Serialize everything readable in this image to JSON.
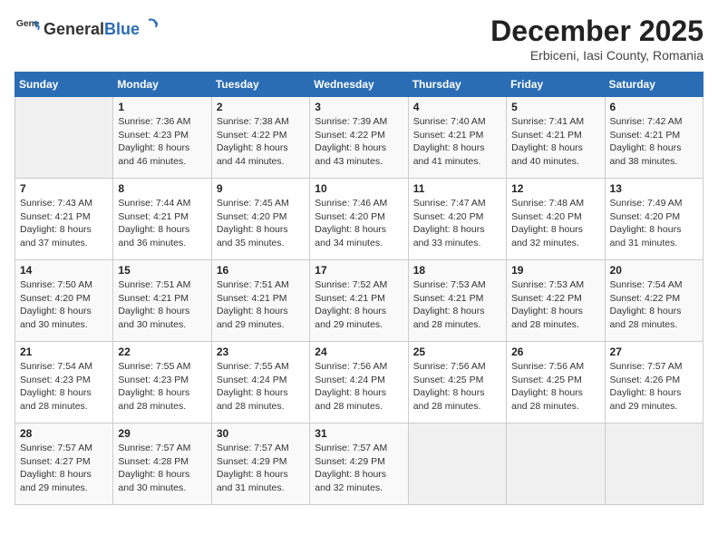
{
  "logo": {
    "general": "General",
    "blue": "Blue"
  },
  "header": {
    "title": "December 2025",
    "subtitle": "Erbiceni, Iasi County, Romania"
  },
  "weekdays": [
    "Sunday",
    "Monday",
    "Tuesday",
    "Wednesday",
    "Thursday",
    "Friday",
    "Saturday"
  ],
  "weeks": [
    [
      {
        "day": "",
        "info": ""
      },
      {
        "day": "1",
        "info": "Sunrise: 7:36 AM\nSunset: 4:23 PM\nDaylight: 8 hours\nand 46 minutes."
      },
      {
        "day": "2",
        "info": "Sunrise: 7:38 AM\nSunset: 4:22 PM\nDaylight: 8 hours\nand 44 minutes."
      },
      {
        "day": "3",
        "info": "Sunrise: 7:39 AM\nSunset: 4:22 PM\nDaylight: 8 hours\nand 43 minutes."
      },
      {
        "day": "4",
        "info": "Sunrise: 7:40 AM\nSunset: 4:21 PM\nDaylight: 8 hours\nand 41 minutes."
      },
      {
        "day": "5",
        "info": "Sunrise: 7:41 AM\nSunset: 4:21 PM\nDaylight: 8 hours\nand 40 minutes."
      },
      {
        "day": "6",
        "info": "Sunrise: 7:42 AM\nSunset: 4:21 PM\nDaylight: 8 hours\nand 38 minutes."
      }
    ],
    [
      {
        "day": "7",
        "info": "Sunrise: 7:43 AM\nSunset: 4:21 PM\nDaylight: 8 hours\nand 37 minutes."
      },
      {
        "day": "8",
        "info": "Sunrise: 7:44 AM\nSunset: 4:21 PM\nDaylight: 8 hours\nand 36 minutes."
      },
      {
        "day": "9",
        "info": "Sunrise: 7:45 AM\nSunset: 4:20 PM\nDaylight: 8 hours\nand 35 minutes."
      },
      {
        "day": "10",
        "info": "Sunrise: 7:46 AM\nSunset: 4:20 PM\nDaylight: 8 hours\nand 34 minutes."
      },
      {
        "day": "11",
        "info": "Sunrise: 7:47 AM\nSunset: 4:20 PM\nDaylight: 8 hours\nand 33 minutes."
      },
      {
        "day": "12",
        "info": "Sunrise: 7:48 AM\nSunset: 4:20 PM\nDaylight: 8 hours\nand 32 minutes."
      },
      {
        "day": "13",
        "info": "Sunrise: 7:49 AM\nSunset: 4:20 PM\nDaylight: 8 hours\nand 31 minutes."
      }
    ],
    [
      {
        "day": "14",
        "info": "Sunrise: 7:50 AM\nSunset: 4:20 PM\nDaylight: 8 hours\nand 30 minutes."
      },
      {
        "day": "15",
        "info": "Sunrise: 7:51 AM\nSunset: 4:21 PM\nDaylight: 8 hours\nand 30 minutes."
      },
      {
        "day": "16",
        "info": "Sunrise: 7:51 AM\nSunset: 4:21 PM\nDaylight: 8 hours\nand 29 minutes."
      },
      {
        "day": "17",
        "info": "Sunrise: 7:52 AM\nSunset: 4:21 PM\nDaylight: 8 hours\nand 29 minutes."
      },
      {
        "day": "18",
        "info": "Sunrise: 7:53 AM\nSunset: 4:21 PM\nDaylight: 8 hours\nand 28 minutes."
      },
      {
        "day": "19",
        "info": "Sunrise: 7:53 AM\nSunset: 4:22 PM\nDaylight: 8 hours\nand 28 minutes."
      },
      {
        "day": "20",
        "info": "Sunrise: 7:54 AM\nSunset: 4:22 PM\nDaylight: 8 hours\nand 28 minutes."
      }
    ],
    [
      {
        "day": "21",
        "info": "Sunrise: 7:54 AM\nSunset: 4:23 PM\nDaylight: 8 hours\nand 28 minutes."
      },
      {
        "day": "22",
        "info": "Sunrise: 7:55 AM\nSunset: 4:23 PM\nDaylight: 8 hours\nand 28 minutes."
      },
      {
        "day": "23",
        "info": "Sunrise: 7:55 AM\nSunset: 4:24 PM\nDaylight: 8 hours\nand 28 minutes."
      },
      {
        "day": "24",
        "info": "Sunrise: 7:56 AM\nSunset: 4:24 PM\nDaylight: 8 hours\nand 28 minutes."
      },
      {
        "day": "25",
        "info": "Sunrise: 7:56 AM\nSunset: 4:25 PM\nDaylight: 8 hours\nand 28 minutes."
      },
      {
        "day": "26",
        "info": "Sunrise: 7:56 AM\nSunset: 4:25 PM\nDaylight: 8 hours\nand 28 minutes."
      },
      {
        "day": "27",
        "info": "Sunrise: 7:57 AM\nSunset: 4:26 PM\nDaylight: 8 hours\nand 29 minutes."
      }
    ],
    [
      {
        "day": "28",
        "info": "Sunrise: 7:57 AM\nSunset: 4:27 PM\nDaylight: 8 hours\nand 29 minutes."
      },
      {
        "day": "29",
        "info": "Sunrise: 7:57 AM\nSunset: 4:28 PM\nDaylight: 8 hours\nand 30 minutes."
      },
      {
        "day": "30",
        "info": "Sunrise: 7:57 AM\nSunset: 4:29 PM\nDaylight: 8 hours\nand 31 minutes."
      },
      {
        "day": "31",
        "info": "Sunrise: 7:57 AM\nSunset: 4:29 PM\nDaylight: 8 hours\nand 32 minutes."
      },
      {
        "day": "",
        "info": ""
      },
      {
        "day": "",
        "info": ""
      },
      {
        "day": "",
        "info": ""
      }
    ]
  ]
}
